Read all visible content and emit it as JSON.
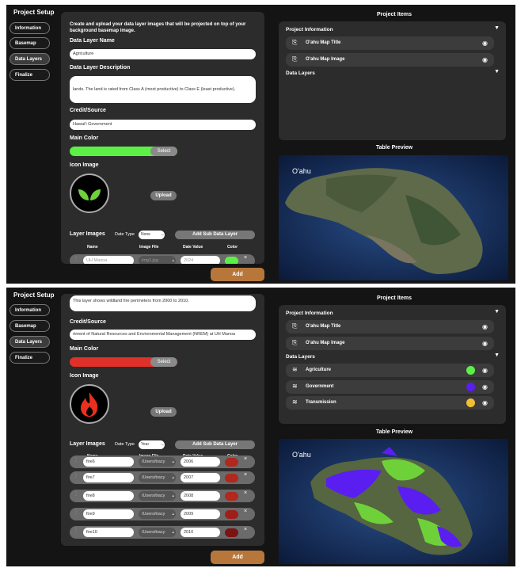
{
  "top": {
    "sidebar": {
      "title": "Project Setup",
      "items": [
        "Information",
        "Basemap",
        "Data Layers",
        "Finalize"
      ],
      "active": "Data Layers"
    },
    "form": {
      "intro": "Create and upload your data layer images that will be projected on top of your background basemap image.",
      "name_label": "Data Layer Name",
      "name_value": "Agriculture",
      "desc_label": "Data Layer Description",
      "desc_value": "lands. The land is rated from Class A (most productive) to Class E (least productive).",
      "credit_label": "Credit/Source",
      "credit_value": "Hawai'i Government",
      "main_color_label": "Main Color",
      "main_color": "#5cf046",
      "select_label": "Select",
      "icon_label": "Icon Image",
      "upload_label": "Upload",
      "layer_images_label": "Layer Images",
      "date_type_label": "Date Type",
      "date_type_value": "None",
      "add_sub_label": "Add Sub Data Layer",
      "columns": [
        "Name",
        "Image File",
        "Date Value",
        "Color"
      ],
      "rows": [
        {
          "name": "UH Manoa",
          "file": "img1.jpg",
          "date": "2024",
          "color": "#5cf046"
        }
      ]
    },
    "add_label": "Add",
    "items": {
      "title": "Project Items",
      "project_info_label": "Project Information",
      "project_items": [
        "O'ahu Map Title",
        "O'ahu Map Image"
      ],
      "data_layers_label": "Data Layers",
      "data_layers": []
    },
    "preview": {
      "title": "Table Preview",
      "map_label": "O'ahu"
    }
  },
  "bottom": {
    "sidebar": {
      "title": "Project Setup",
      "items": [
        "Information",
        "Basemap",
        "Data Layers",
        "Finalize"
      ],
      "active": "Data Layers"
    },
    "form": {
      "desc_value": "This layer shows wildland fire perimeters from 2000 to 2010.",
      "credit_label": "Credit/Source",
      "credit_value": "rtment of Natural Resources and Environmental Management (NREM) at UH Manoa",
      "main_color_label": "Main Color",
      "main_color": "#e0302a",
      "select_label": "Select",
      "icon_label": "Icon Image",
      "upload_label": "Upload",
      "layer_images_label": "Layer Images",
      "date_type_label": "Date Type",
      "date_type_value": "Year",
      "add_sub_label": "Add Sub Data Layer",
      "columns": [
        "Name",
        "Image File",
        "Date Value",
        "Color"
      ],
      "rows": [
        {
          "name": "fire6",
          "file": "/Users/tracy",
          "date": "2006",
          "color": "#b0281e"
        },
        {
          "name": "fire7",
          "file": "/Users/tracy",
          "date": "2007",
          "color": "#b0281e"
        },
        {
          "name": "fire8",
          "file": "/Users/tracy",
          "date": "2008",
          "color": "#b0281e"
        },
        {
          "name": "fire9",
          "file": "/Users/tracy",
          "date": "2009",
          "color": "#a01e1a"
        },
        {
          "name": "fire10",
          "file": "/Users/tracy",
          "date": "2010",
          "color": "#7a1414"
        }
      ]
    },
    "add_label": "Add",
    "items": {
      "title": "Project Items",
      "project_info_label": "Project Information",
      "project_items": [
        "O'ahu Map Title",
        "O'ahu Map Image"
      ],
      "data_layers_label": "Data Layers",
      "data_layers": [
        {
          "label": "Agriculture",
          "color": "#5cf046"
        },
        {
          "label": "Government",
          "color": "#5a1ef0"
        },
        {
          "label": "Transmission",
          "color": "#f0c030"
        }
      ]
    },
    "preview": {
      "title": "Table Preview",
      "map_label": "O'ahu"
    }
  }
}
